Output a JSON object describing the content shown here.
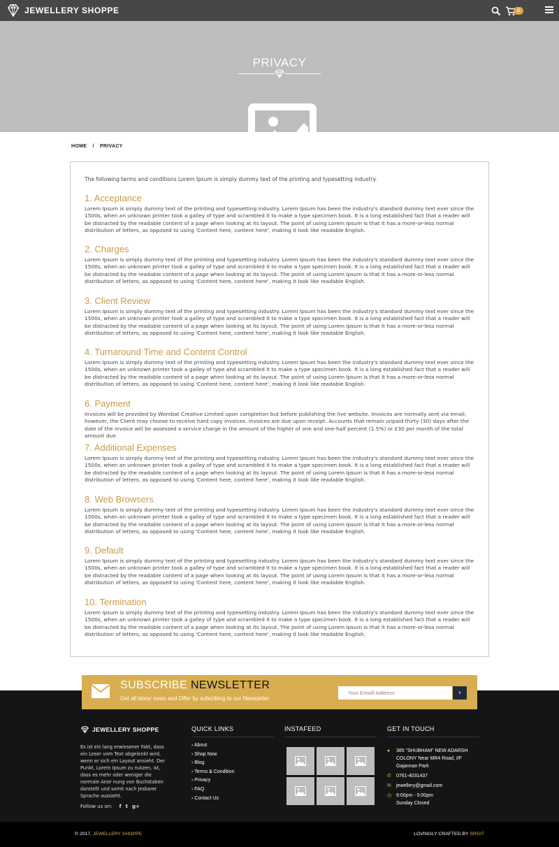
{
  "header": {
    "brand": "JEWELLERY SHOPPE",
    "cart_count": "0",
    "icons": [
      "diamond-logo-icon",
      "search-icon",
      "cart-icon",
      "hamburger-menu-icon"
    ]
  },
  "hero": {
    "title": "PRIVACY"
  },
  "breadcrumb": {
    "home": "HOME",
    "separator": "/",
    "current": "PRIVACY"
  },
  "content": {
    "intro": "The following terms and conditions Lorem Ipsum is simply dummy text of the printing and typesetting industry.",
    "sections": [
      {
        "title": "1. Acceptance",
        "body": "Lorem Ipsum is simply dummy text of the printing and typesetting industry. Lorem Ipsum has been the industry's standard dummy text ever since the 1500s, when an unknown printer took a galley of type and scrambled it to make a type specimen book. It is a long established fact that a reader will be distracted by the readable content of a page when looking at its layout. The point of using Lorem Ipsum is that it has a more-or-less normal distribution of letters, as opposed to using 'Content here, content here', making it look like readable English."
      },
      {
        "title": "2. Charges",
        "body": "Lorem Ipsum is simply dummy text of the printing and typesetting industry. Lorem Ipsum has been the industry's standard dummy text ever since the 1500s, when an unknown printer took a galley of type and scrambled it to make a type specimen book. It is a long established fact that a reader will be distracted by the readable content of a page when looking at its layout. The point of using Lorem Ipsum is that it has a more-or-less normal distribution of letters, as opposed to using 'Content here, content here', making it look like readable English."
      },
      {
        "title": "3. Client Review",
        "body": "Lorem Ipsum is simply dummy text of the printing and typesetting industry. Lorem Ipsum has been the industry's standard dummy text ever since the 1500s, when an unknown printer took a galley of type and scrambled it to make a type specimen book. It is a long established fact that a reader will be distracted by the readable content of a page when looking at its layout. The point of using Lorem Ipsum is that it has a more-or-less normal distribution of letters, as opposed to using 'Content here, content here', making it look like readable English."
      },
      {
        "title": "4. Turnaround Time and Content Control",
        "body": "Lorem Ipsum is simply dummy text of the printing and typesetting industry. Lorem Ipsum has been the industry's standard dummy text ever since the 1500s, when an unknown printer took a galley of type and scrambled it to make a type specimen book. It is a long established fact that a reader will be distracted by the readable content of a page when looking at its layout. The point of using Lorem Ipsum is that it has a more-or-less normal distribution of letters, as opposed to using 'Content here, content here', making it look like readable English."
      },
      {
        "title": "6. Payment",
        "body": "Invoices will be provided by Wombat Creative Limited upon completion but before publishing the live website. Invoices are normally sent via email; however, the Client may choose to receive hard copy invoices. Invoices are due upon receipt. Accounts that remain unpaid thirty (30) days after the date of the invoice will be assessed a service charge in the amount of the higher of one and one-half percent (1.5%) or £30 per month of the total amount due."
      },
      {
        "title": "7. Additional Expenses",
        "body": "Lorem Ipsum is simply dummy text of the printing and typesetting industry. Lorem Ipsum has been the industry's standard dummy text ever since the 1500s, when an unknown printer took a galley of type and scrambled it to make a type specimen book. It is a long established fact that a reader will be distracted by the readable content of a page when looking at its layout. The point of using Lorem Ipsum is that it has a more-or-less normal distribution of letters, as opposed to using 'Content here, content here', making it look like readable English."
      },
      {
        "title": "8. Web Browsers",
        "body": "Lorem Ipsum is simply dummy text of the printing and typesetting industry. Lorem Ipsum has been the industry's standard dummy text ever since the 1500s, when an unknown printer took a galley of type and scrambled it to make a type specimen book. It is a long established fact that a reader will be distracted by the readable content of a page when looking at its layout. The point of using Lorem Ipsum is that it has a more-or-less normal distribution of letters, as opposed to using 'Content here, content here', making it look like readable English."
      },
      {
        "title": "9. Default",
        "body": "Lorem Ipsum is simply dummy text of the printing and typesetting industry. Lorem Ipsum has been the industry's standard dummy text ever since the 1500s, when an unknown printer took a galley of type and scrambled it to make a type specimen book. It is a long established fact that a reader will be distracted by the readable content of a page when looking at its layout. The point of using Lorem Ipsum is that it has a more-or-less normal distribution of letters, as opposed to using 'Content here, content here', making it look like readable English."
      },
      {
        "title": "10. Termination",
        "body": "Lorem Ipsum is simply dummy text of the printing and typesetting industry. Lorem Ipsum has been the industry's standard dummy text ever since the 1500s, when an unknown printer took a galley of type and scrambled it to make a type specimen book. It is a long established fact that a reader will be distracted by the readable content of a page when looking at its layout. The point of using Lorem Ipsum is that it has a more-or-less normal distribution of letters, as opposed to using 'Content here, content here', making it look like readable English."
      }
    ]
  },
  "newsletter": {
    "title_light": "SUBSCRIBE",
    "title_bold": "NEWSLETTER",
    "subtitle": "Get all latesr news and Offer by subcribing to our Newsletter",
    "placeholder": "Your Emaill Address",
    "submit_glyph": "›"
  },
  "footer": {
    "brand": "JEWELLERY SHOPPE",
    "about": "Es ist ein lang erwiesener Fakt, dass ein Leser vom Text abgelenkt wird, wenn er sich ein Layout ansieht. Der Punkt, Lorem Ipsum zu nutzen, ist, dass es mehr oder weniger die normale Anor nung von Buchstaben darstellt und somit nach Jesbarer Sprache aussieht.",
    "follow_label": "Follow us on:",
    "social": {
      "facebook": "f",
      "twitter": "t",
      "google": "g+"
    },
    "quick_links_heading": "QUICK LINKS",
    "quick_links": [
      "About",
      "Shop Now",
      "Blog",
      "Terms & Condition",
      "Privacy",
      "FAQ",
      "Contact Us"
    ],
    "instafeed_heading": "INSTAFEED",
    "get_in_touch_heading": "GET IN TOUCH",
    "address_line1": "385 \"SHUBHAM\" NEW ADARSH",
    "address_line2": "COLONY Near MR4 Road, I/F",
    "address_line3": "Gajannan Park",
    "phone": "0761-4031437",
    "email": "jewellery@gmail.com",
    "hours": "9:00pm - 5:00pm",
    "closed": "Sunday Closed",
    "copyright_prefix": "© 2017,",
    "copyright_brand": "JEWELLERY SHOPPE",
    "credit_prefix": "LOVINGLY CRAFTED BY",
    "credit_brand": "SRGIT"
  },
  "colors": {
    "accent_gold": "#d9ae50",
    "heading_gold": "#c89b49",
    "header_bg": "#474747",
    "hero_bg": "#bdbdbd",
    "footer_bg": "#151515"
  }
}
